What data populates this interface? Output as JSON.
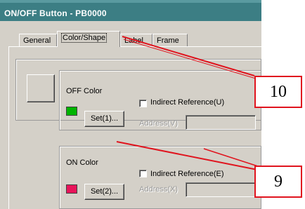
{
  "window": {
    "title": "ON/OFF Button - PB0000"
  },
  "tabs": [
    {
      "label": "General"
    },
    {
      "label": "Color/Shape"
    },
    {
      "label": "Label"
    },
    {
      "label": "Frame"
    }
  ],
  "off_group": {
    "label": "OFF Color",
    "swatch_color": "#00b400",
    "set_button": "Set(1)...",
    "indirect_label": "Indirect Reference(U)",
    "address_label": "Address(V)"
  },
  "on_group": {
    "label": "ON Color",
    "swatch_color": "#e8145a",
    "set_button": "Set(2)...",
    "indirect_label": "Indirect Reference(E)",
    "address_label": "Address(X)"
  },
  "callouts": [
    {
      "label": "10"
    },
    {
      "label": "9"
    }
  ],
  "colors": {
    "title_bar": "#3c7e84",
    "callout_border": "#e0141e"
  }
}
